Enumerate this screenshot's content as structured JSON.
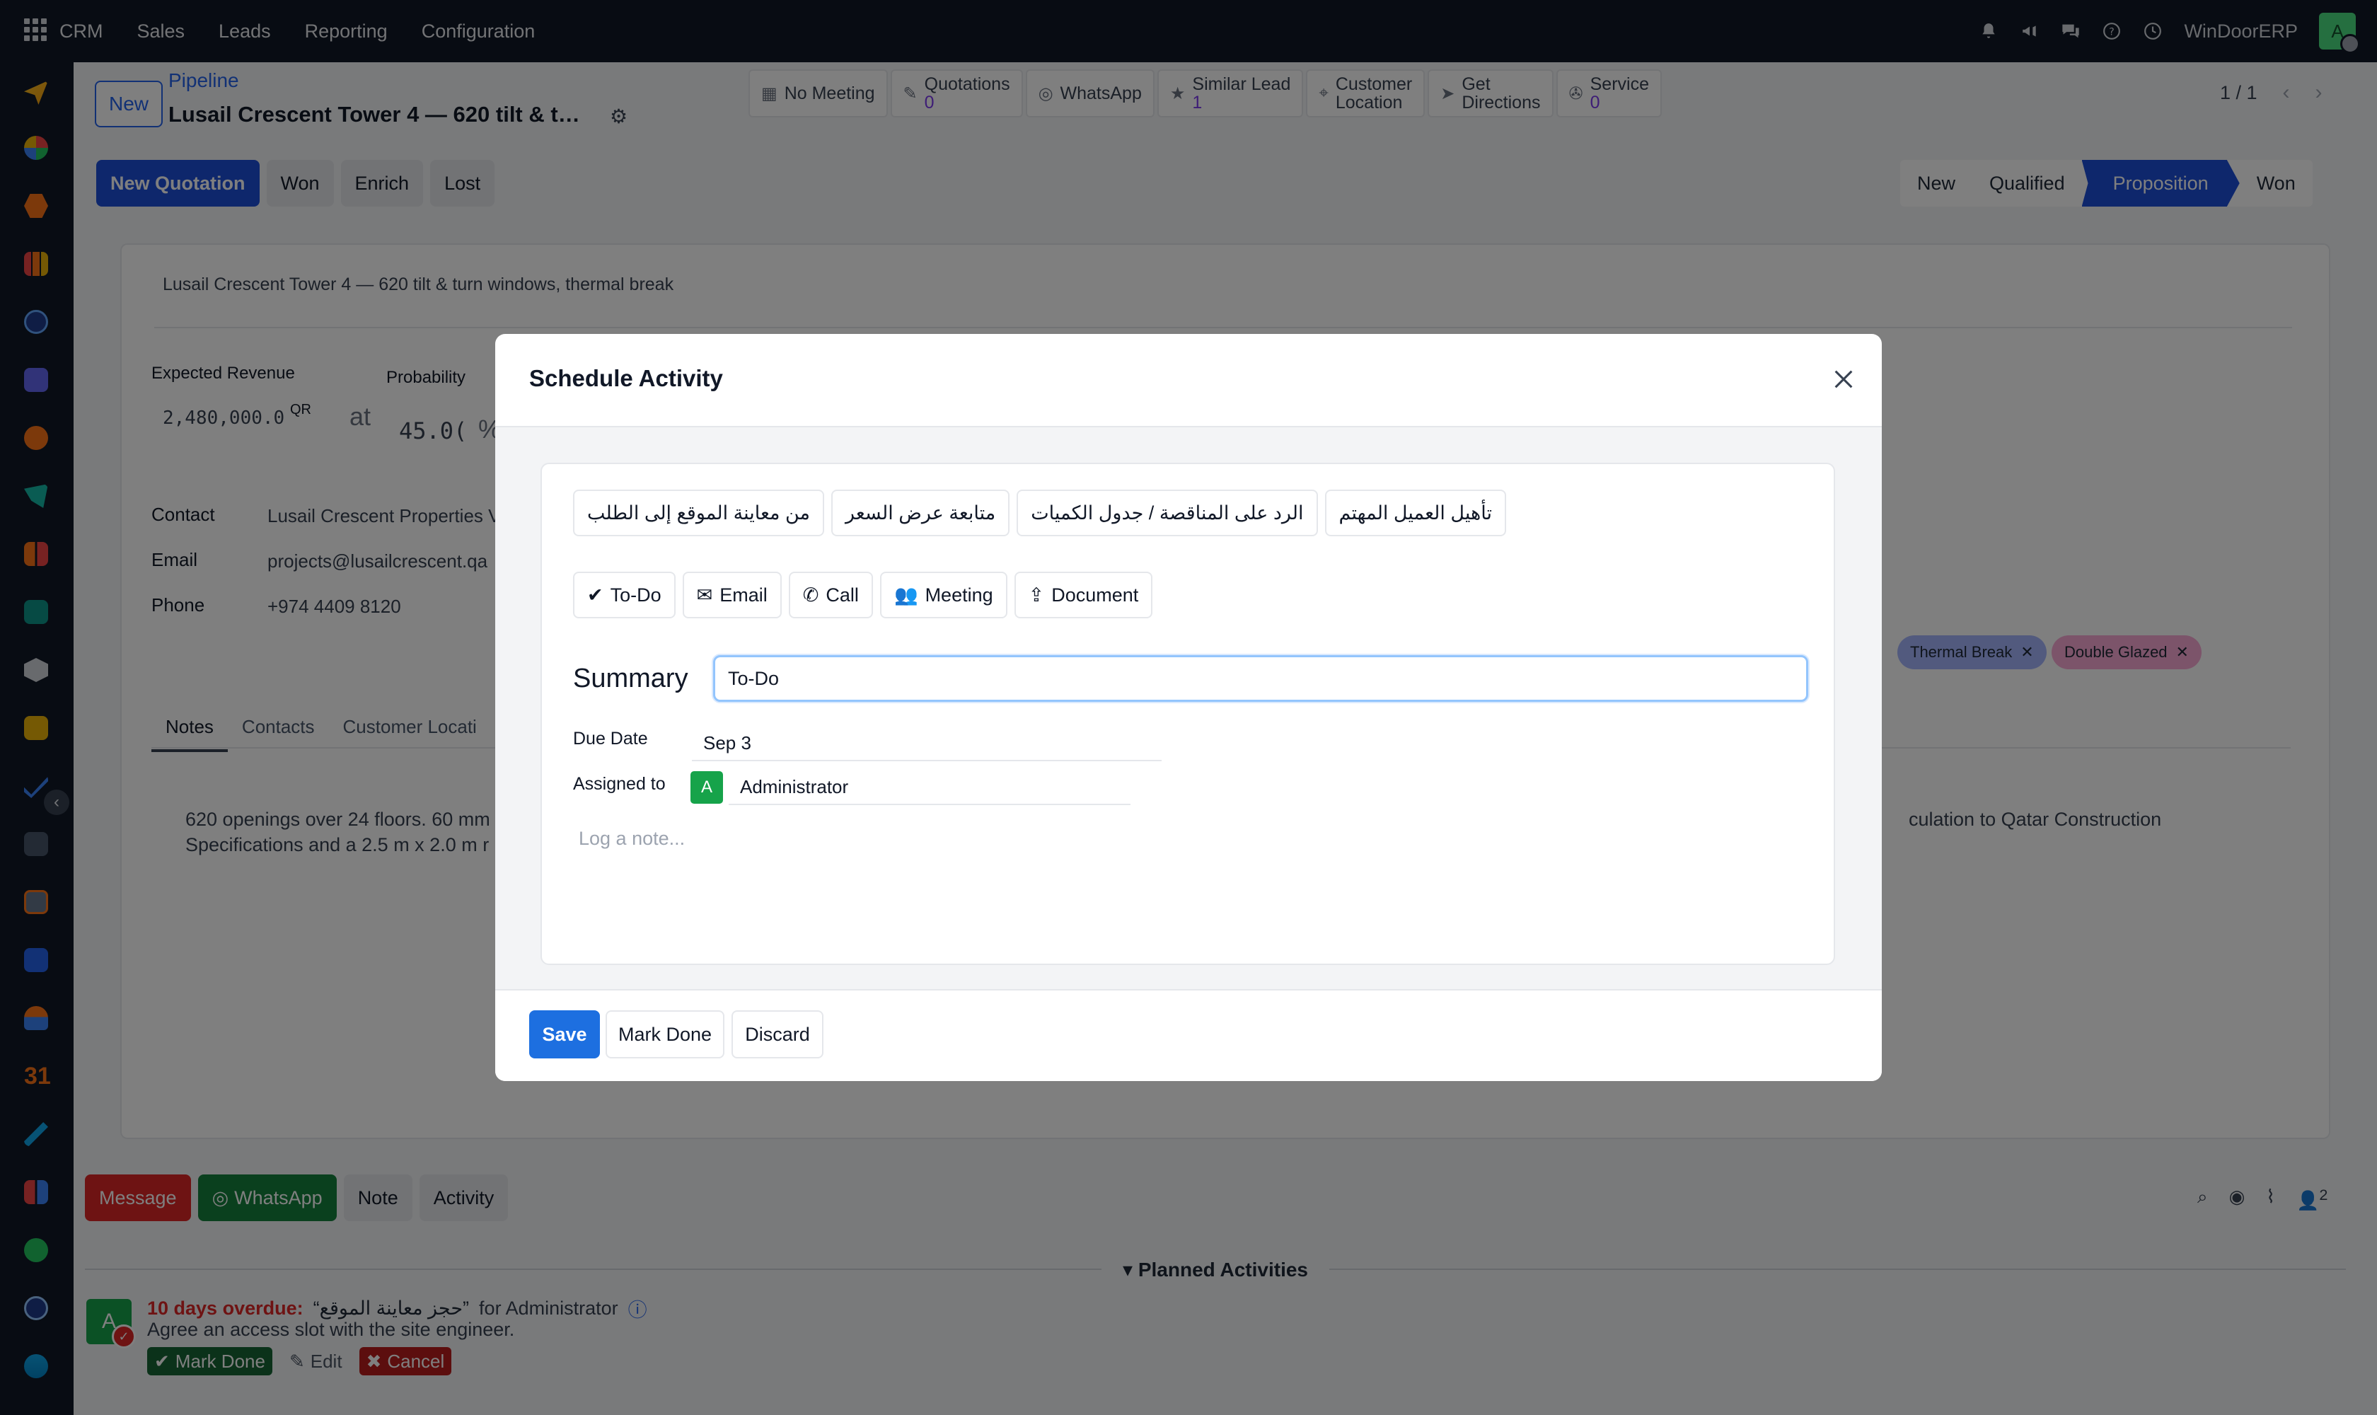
{
  "topbar": {
    "nav": [
      "CRM",
      "Sales",
      "Leads",
      "Reporting",
      "Configuration"
    ],
    "company": "WinDoorERP",
    "user_initial": "A"
  },
  "control": {
    "new_label": "New",
    "breadcrumb": "Pipeline",
    "record_title": "Lusail Crescent Tower 4 — 620 tilt & turn windows, thermal break",
    "pager": "1 / 1"
  },
  "smart_buttons": {
    "no_meeting": "No Meeting",
    "quotations": "Quotations",
    "quotations_count": "0",
    "whatsapp": "WhatsApp",
    "similar_lead": "Similar Lead",
    "similar_lead_count": "1",
    "customer": "Customer",
    "location": "Location",
    "get": "Get",
    "directions": "Directions",
    "service": "Service",
    "service_count": "0"
  },
  "actions": {
    "new_quotation": "New Quotation",
    "won": "Won",
    "enrich": "Enrich",
    "lost": "Lost"
  },
  "stages": {
    "new": "New",
    "qualified": "Qualified",
    "proposition": "Proposition",
    "won": "Won"
  },
  "form": {
    "description": "Lusail Crescent Tower 4 — 620 tilt & turn windows, thermal break",
    "expected_revenue_label": "Expected Revenue",
    "expected_revenue": "2,480,000.0",
    "currency": "QR",
    "at": "at",
    "probability_label": "Probability",
    "probability": "45.0(",
    "percent": "%",
    "contact_label": "Contact",
    "contact_value": "Lusail Crescent Properties V",
    "email_label": "Email",
    "email_value": "projects@lusailcrescent.qa",
    "phone_label": "Phone",
    "phone_value": "+974 4409 8120",
    "tag_thermal": "Thermal Break",
    "tag_double": "Double Glazed",
    "tabs": [
      "Notes",
      "Contacts",
      "Customer Locati"
    ],
    "notes_line1_left": "620 openings over 24 floors. 60 mm",
    "notes_line2_left": "Specifications and a 2.5 m x 2.0 m r",
    "notes_line1_right": "culation to Qatar Construction"
  },
  "chatter": {
    "message": "Message",
    "whatsapp": "WhatsApp",
    "note": "Note",
    "activity": "Activity",
    "followers_count": "2",
    "planned_title": "Planned Activities",
    "overdue": "10 days overdue:",
    "activity_name": "“حجز معاينة الموقع”",
    "for_user": "for Administrator",
    "activity_note": "Agree an access slot with the site engineer.",
    "mark_done": "Mark Done",
    "edit": "Edit",
    "cancel": "Cancel",
    "avatar_initial": "A"
  },
  "modal": {
    "title": "Schedule Activity",
    "suggestions": [
      "من معاينة الموقع إلى الطلب",
      "متابعة عرض السعر",
      "الرد على المناقصة / جدول الكميات",
      "تأهيل العميل المهتم"
    ],
    "types": {
      "todo": "To-Do",
      "email": "Email",
      "call": "Call",
      "meeting": "Meeting",
      "document": "Document"
    },
    "summary_label": "Summary",
    "summary_value": "To-Do",
    "due_date_label": "Due Date",
    "due_date": "Sep 3",
    "assigned_label": "Assigned to",
    "assigned_initial": "A",
    "assigned_value": "Administrator",
    "note_placeholder": "Log a note...",
    "save": "Save",
    "mark_done": "Mark Done",
    "discard": "Discard"
  },
  "colors": {
    "primary": "#1d4ed8",
    "topbar": "#111827",
    "danger": "#dc2626",
    "success": "#15803d"
  }
}
